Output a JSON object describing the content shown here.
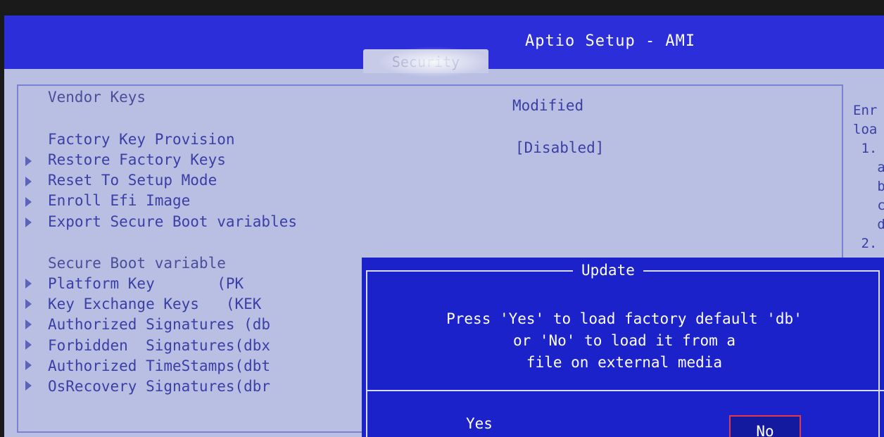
{
  "app": {
    "title": "Aptio Setup - AMI",
    "active_tab": "Security"
  },
  "main": {
    "vendor_keys_label": "Vendor Keys",
    "vendor_keys_value": "Modified",
    "factory_key_label": "Factory Key Provision",
    "factory_key_value": "[Disabled]",
    "actions": [
      "Restore Factory Keys",
      "Reset To Setup Mode",
      "Enroll Efi Image",
      "Export Secure Boot variables"
    ],
    "section_label": "Secure Boot variable",
    "variables": [
      "Platform Key       (PK",
      "Key Exchange Keys   (KEK",
      "Authorized Signatures (db",
      "Forbidden  Signatures(dbx",
      "Authorized TimeStamps(dbt",
      "OsRecovery Signatures(dbr"
    ]
  },
  "help": {
    "lines": [
      "Enr",
      "loa",
      " 1.",
      "   a",
      "   b",
      "   c",
      "   d",
      " 2."
    ]
  },
  "dialog": {
    "title": "Update",
    "message_lines": [
      "Press 'Yes' to load factory default 'db'",
      "or 'No' to load it from a",
      "file on external media"
    ],
    "yes_label": "Yes",
    "no_label": "No"
  },
  "colors": {
    "title_bar": "#2b2ed9",
    "background": "#b9bfe3",
    "dialog_bg": "#1b22c9",
    "selection_border": "#e03a4c"
  }
}
